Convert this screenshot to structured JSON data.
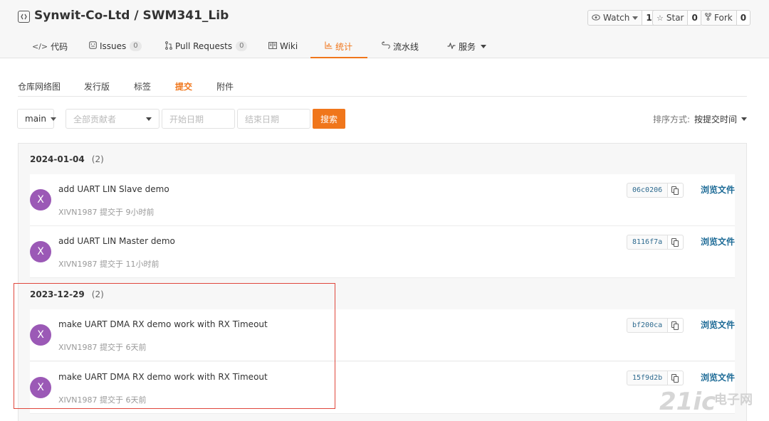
{
  "header": {
    "owner": "Synwit-Co-Ltd",
    "separator": " / ",
    "repo": "SWM341_Lib",
    "watch_label": "Watch",
    "watch_count": "1",
    "star_label": "Star",
    "star_count": "0",
    "fork_label": "Fork",
    "fork_count": "0"
  },
  "tabs": [
    {
      "label": "代码",
      "icon": "code-icon"
    },
    {
      "label": "Issues",
      "badge": "0",
      "icon": "issues-icon"
    },
    {
      "label": "Pull Requests",
      "badge": "0",
      "icon": "pull-request-icon"
    },
    {
      "label": "Wiki",
      "icon": "wiki-icon"
    },
    {
      "label": "统计",
      "icon": "chart-icon",
      "active": true
    },
    {
      "label": "流水线",
      "icon": "pipeline-icon"
    },
    {
      "label": "服务",
      "icon": "service-icon"
    }
  ],
  "subnav": [
    "仓库网络图",
    "发行版",
    "标签",
    "提交",
    "附件"
  ],
  "filters": {
    "branch": "main",
    "contributors_placeholder": "全部贡献者",
    "start_date_placeholder": "开始日期",
    "end_date_placeholder": "结束日期",
    "search_label": "搜索",
    "sort_label": "排序方式:",
    "sort_value": "按提交时间"
  },
  "groups": [
    {
      "date": "2024-01-04",
      "count": "(2)",
      "commits": [
        {
          "avatar": "X",
          "message": "add UART LIN Slave demo",
          "meta": "XIVN1987 提交于 9小时前",
          "sha": "06c0206",
          "browse": "浏览文件"
        },
        {
          "avatar": "X",
          "message": "add UART LIN Master demo",
          "meta": "XIVN1987 提交于 11小时前",
          "sha": "8116f7a",
          "browse": "浏览文件"
        }
      ]
    },
    {
      "date": "2023-12-29",
      "count": "(2)",
      "commits": [
        {
          "avatar": "X",
          "message": "make UART DMA RX demo work with RX Timeout",
          "meta": "XIVN1987 提交于 6天前",
          "sha": "bf200ca",
          "browse": "浏览文件"
        },
        {
          "avatar": "X",
          "message": "make UART DMA RX demo work with RX Timeout",
          "meta": "XIVN1987 提交于 6天前",
          "sha": "15f9d2b",
          "browse": "浏览文件"
        }
      ]
    }
  ],
  "watermark": {
    "main": "21ic",
    "sub": "电子网"
  },
  "colors": {
    "accent": "#f0761b",
    "avatar": "#9b59b6",
    "link": "#1c6a96",
    "highlight": "#e0473c"
  }
}
